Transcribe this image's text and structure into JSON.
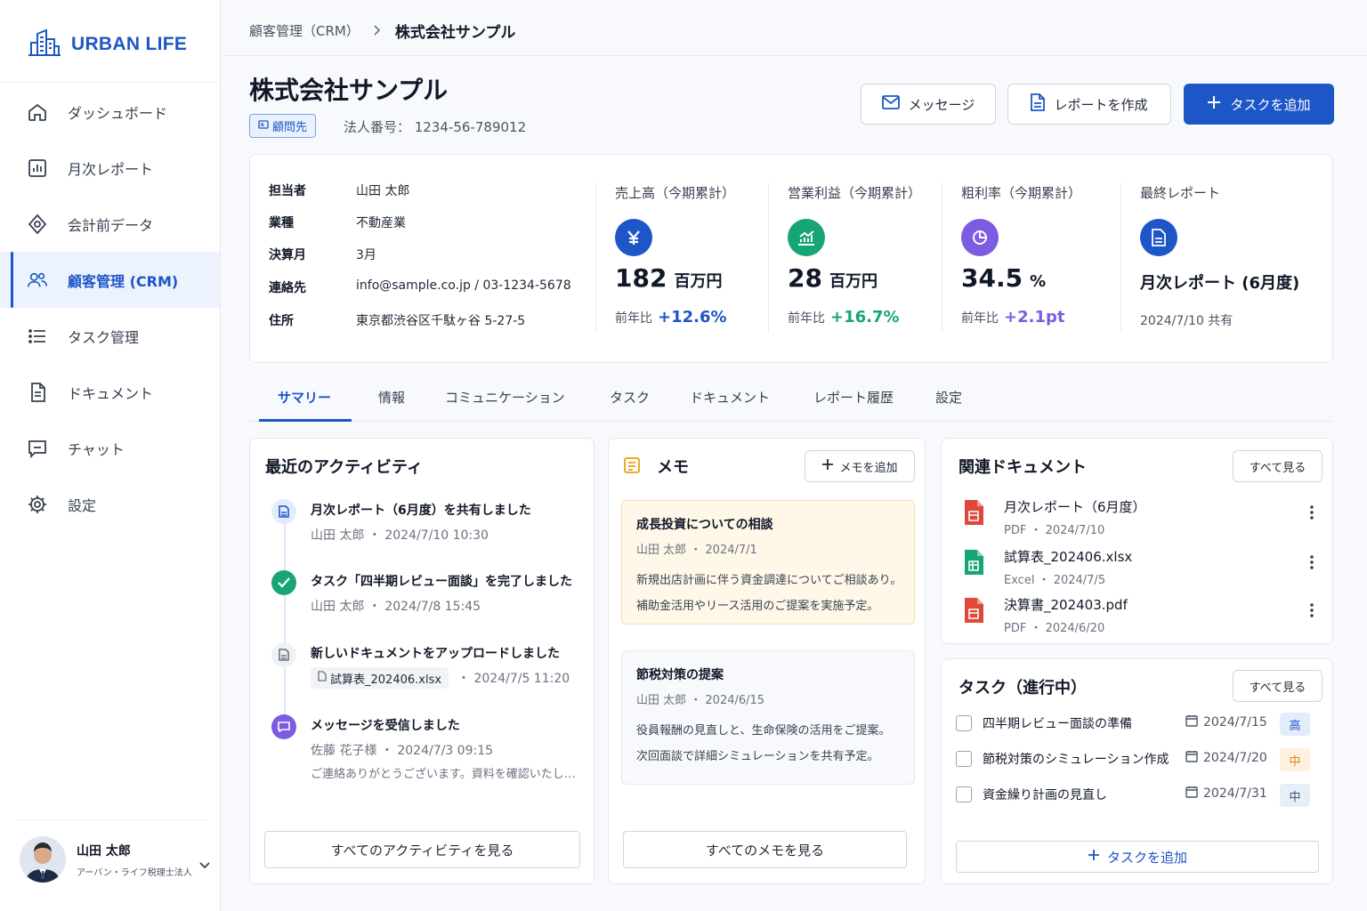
{
  "app": {
    "name": "URBAN LIFE"
  },
  "sidebar": {
    "items": [
      {
        "label": "ダッシュボード",
        "icon": "home-icon"
      },
      {
        "label": "月次レポート",
        "icon": "bar-chart-icon"
      },
      {
        "label": "会計前データ",
        "icon": "diamond-data-icon"
      },
      {
        "label": "顧客管理 (CRM)",
        "icon": "users-icon",
        "active": true
      },
      {
        "label": "タスク管理",
        "icon": "list-icon"
      },
      {
        "label": "ドキュメント",
        "icon": "document-icon"
      },
      {
        "label": "チャット",
        "icon": "chat-icon"
      },
      {
        "label": "設定",
        "icon": "gear-icon"
      }
    ]
  },
  "user": {
    "name": "山田 太郎",
    "org": "アーバン・ライフ税理士法人"
  },
  "breadcrumb": {
    "parent": "顧客管理（CRM）",
    "current": "株式会社サンプル"
  },
  "client": {
    "name": "株式会社サンプル",
    "badge": "顧問先",
    "corp_number": "法人番号： 1234-56-789012"
  },
  "header_buttons": {
    "message": "メッセージ",
    "report": "レポートを作成",
    "add_task": "タスクを追加"
  },
  "info": {
    "rows": [
      {
        "k": "担当者",
        "v": "山田 太郎"
      },
      {
        "k": "業種",
        "v": "不動産業"
      },
      {
        "k": "決算月",
        "v": "3月"
      },
      {
        "k": "連絡先",
        "v": "info@sample.co.jp / 03-1234-5678"
      },
      {
        "k": "住所",
        "v": "東京都渋谷区千駄ヶ谷 5-27-5"
      }
    ],
    "metrics": [
      {
        "label": "売上高（今期累計）",
        "value": "182",
        "unit": "百万円",
        "cmp_label": "前年比",
        "cmp": "+12.6%",
        "color": "#1d56c7",
        "icon": "yen-icon"
      },
      {
        "label": "営業利益（今期累計）",
        "value": "28",
        "unit": "百万円",
        "cmp_label": "前年比",
        "cmp": "+16.7%",
        "color": "#18a574",
        "icon": "trend-chart-icon"
      },
      {
        "label": "粗利率（今期累計）",
        "value": "34.5",
        "unit": "%",
        "cmp_label": "前年比",
        "cmp": "+2.1pt",
        "color": "#7c5ce0",
        "icon": "pie-chart-icon"
      }
    ],
    "last_report": {
      "label": "最終レポート",
      "title": "月次レポート (6月度)",
      "shared": "2024/7/10 共有",
      "color": "#1d56c7"
    }
  },
  "tabs": [
    "サマリー",
    "情報",
    "コミュニケーション",
    "タスク",
    "ドキュメント",
    "レポート履歴",
    "設定"
  ],
  "activity": {
    "title": "最近のアクティビティ",
    "items": [
      {
        "title": "月次レポート（6月度）を共有しました",
        "meta": "山田 太郎 ・ 2024/7/10 10:30"
      },
      {
        "title": "タスク「四半期レビュー面談」を完了しました",
        "meta": "山田 太郎 ・ 2024/7/8 15:45"
      },
      {
        "title": "新しいドキュメントをアップロードしました",
        "file": "試算表_202406.xlsx",
        "meta": "・ 2024/7/5 11:20"
      },
      {
        "title": "メッセージを受信しました",
        "meta": "佐藤 花子様 ・ 2024/7/3 09:15",
        "snippet": "ご連絡ありがとうございます。資料を確認いたし…"
      }
    ],
    "view_all": "すべてのアクティビティを見る"
  },
  "memo": {
    "title": "メモ",
    "add": "メモを追加",
    "items": [
      {
        "title": "成長投資についての相談",
        "meta": "山田 太郎 ・ 2024/7/1",
        "lines": [
          "新規出店計画に伴う資金調達についてご相談あり。",
          "補助金活用やリース活用のご提案を実施予定。"
        ]
      },
      {
        "title": "節税対策の提案",
        "meta": "山田 太郎 ・ 2024/6/15",
        "lines": [
          "役員報酬の見直しと、生命保険の活用をご提案。",
          "次回面談で詳細シミュレーションを共有予定。"
        ]
      }
    ],
    "view_all": "すべてのメモを見る"
  },
  "documents": {
    "title": "関連ドキュメント",
    "view_all": "すべて見る",
    "items": [
      {
        "name": "月次レポート（6月度）",
        "meta": "PDF ・ 2024/7/10",
        "color": "#e0483b"
      },
      {
        "name": "試算表_202406.xlsx",
        "meta": "Excel ・ 2024/7/5",
        "color": "#18a574"
      },
      {
        "name": "決算書_202403.pdf",
        "meta": "PDF ・ 2024/6/20",
        "color": "#e0483b"
      }
    ]
  },
  "tasks": {
    "title": "タスク（進行中）",
    "view_all": "すべて見る",
    "items": [
      {
        "name": "四半期レビュー面談の準備",
        "date": "2024/7/15",
        "priority": "高"
      },
      {
        "name": "節税対策のシミュレーション作成",
        "date": "2024/7/20",
        "priority": "中"
      },
      {
        "name": "資金繰り計画の見直し",
        "date": "2024/7/31",
        "priority": "中"
      }
    ],
    "add": "タスクを追加"
  }
}
